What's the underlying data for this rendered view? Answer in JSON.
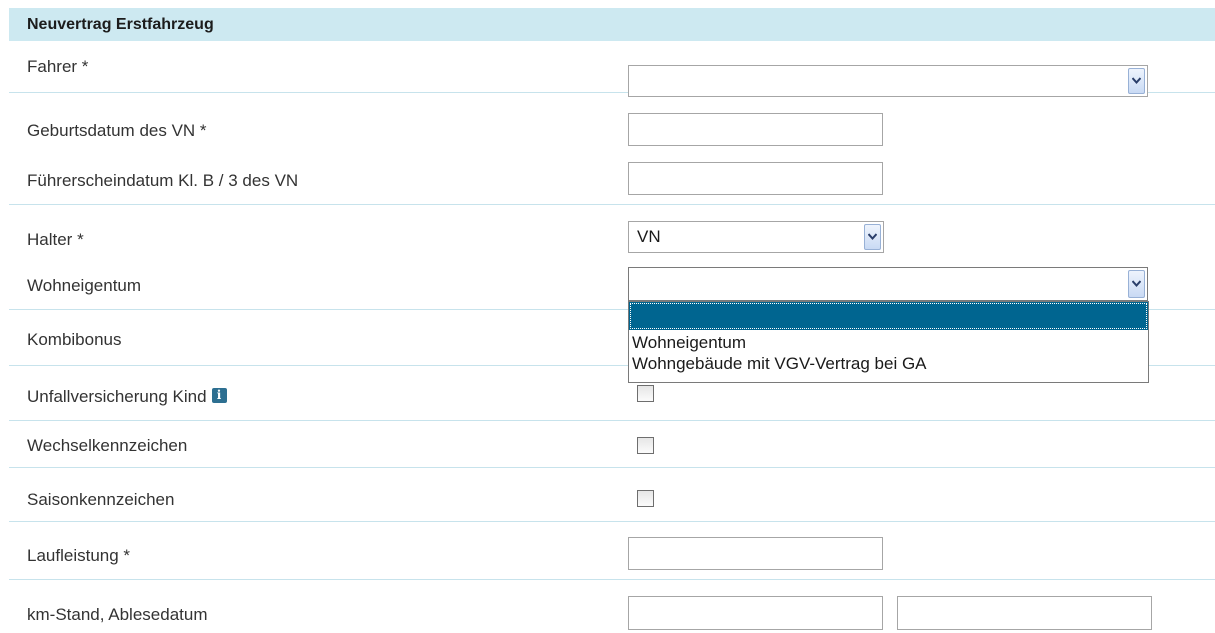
{
  "section": {
    "title": "Neuvertrag Erstfahrzeug"
  },
  "fields": {
    "fahrer": {
      "label": "Fahrer *",
      "value": ""
    },
    "geburtsdatum": {
      "label": "Geburtsdatum des VN *",
      "value": ""
    },
    "fuehrerscheindatum": {
      "label": "Führerscheindatum Kl. B / 3 des VN",
      "value": ""
    },
    "halter": {
      "label": "Halter *",
      "value": "VN"
    },
    "wohneigentum": {
      "label": "Wohneigentum",
      "value": "",
      "options": [
        "",
        "Wohneigentum",
        "Wohngebäude mit VGV-Vertrag bei GA"
      ]
    },
    "kombibonus": {
      "label": "Kombibonus"
    },
    "unfallversicherung": {
      "label": "Unfallversicherung Kind",
      "info_icon": "i",
      "checked": false
    },
    "wechselkennzeichen": {
      "label": "Wechselkennzeichen",
      "checked": false
    },
    "saisonkennzeichen": {
      "label": "Saisonkennzeichen",
      "checked": false
    },
    "laufleistung": {
      "label": "Laufleistung *",
      "value": ""
    },
    "km_stand": {
      "label": "km-Stand, Ablesedatum",
      "km_value": "",
      "date_value": ""
    }
  },
  "icons": {
    "dropdown_arrow": "chevron-down-icon",
    "info": "info-icon"
  },
  "colors": {
    "header_bg": "#cde9f1",
    "row_divider": "#c7e3ec",
    "selected_option_bg": "#006590",
    "info_icon_bg": "#2d6f91"
  }
}
